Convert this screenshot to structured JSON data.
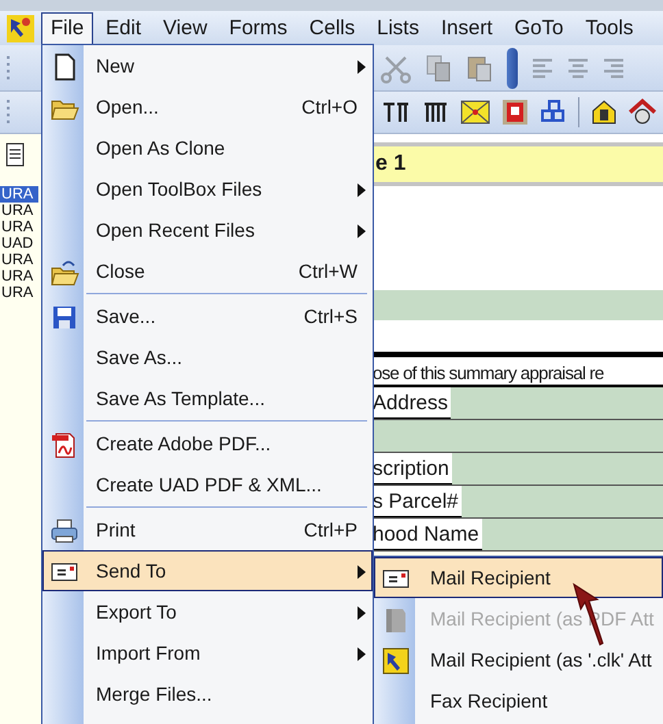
{
  "menu_bar": [
    {
      "label": "File",
      "selected": true
    },
    {
      "label": "Edit",
      "selected": false
    },
    {
      "label": "View",
      "selected": false
    },
    {
      "label": "Forms",
      "selected": false
    },
    {
      "label": "Cells",
      "selected": false
    },
    {
      "label": "Lists",
      "selected": false
    },
    {
      "label": "Insert",
      "selected": false
    },
    {
      "label": "GoTo",
      "selected": false
    },
    {
      "label": "Tools",
      "selected": false
    }
  ],
  "side_panel": {
    "items": [
      {
        "label": "URA",
        "selected": true
      },
      {
        "label": "URA",
        "selected": false
      },
      {
        "label": "URA",
        "selected": false
      },
      {
        "label": "UAD",
        "selected": false
      },
      {
        "label": "URA",
        "selected": false
      },
      {
        "label": "URA",
        "selected": false
      },
      {
        "label": "URA",
        "selected": false
      }
    ]
  },
  "document": {
    "header": "e 1",
    "rows": [
      {
        "kind": "heading",
        "label": "ose of this summary appraisal re"
      },
      {
        "kind": "field",
        "label": "Address"
      },
      {
        "kind": "band"
      },
      {
        "kind": "field",
        "label": "scription"
      },
      {
        "kind": "field",
        "label": "s Parcel#"
      },
      {
        "kind": "field",
        "label": "hood Name"
      }
    ]
  },
  "file_menu": {
    "items": [
      {
        "kind": "item",
        "label": "New",
        "submenu": true,
        "selected": false
      },
      {
        "kind": "item",
        "label": "Open...",
        "shortcut": "Ctrl+O",
        "selected": false
      },
      {
        "kind": "item",
        "label": "Open As Clone",
        "submenu": false,
        "selected": false
      },
      {
        "kind": "item",
        "label": "Open ToolBox Files",
        "submenu": true,
        "selected": false
      },
      {
        "kind": "item",
        "label": "Open Recent Files",
        "submenu": true,
        "selected": false
      },
      {
        "kind": "item",
        "label": "Close",
        "shortcut": "Ctrl+W",
        "selected": false
      },
      {
        "kind": "separator"
      },
      {
        "kind": "item",
        "label": "Save...",
        "shortcut": "Ctrl+S",
        "selected": false
      },
      {
        "kind": "item",
        "label": "Save As...",
        "selected": false
      },
      {
        "kind": "item",
        "label": "Save As Template...",
        "selected": false
      },
      {
        "kind": "separator"
      },
      {
        "kind": "item",
        "label": "Create Adobe PDF...",
        "selected": false
      },
      {
        "kind": "item",
        "label": "Create UAD PDF & XML...",
        "selected": false
      },
      {
        "kind": "separator"
      },
      {
        "kind": "item",
        "label": "Print",
        "shortcut": "Ctrl+P",
        "selected": false
      },
      {
        "kind": "item",
        "label": "Send To",
        "submenu": true,
        "selected": true
      },
      {
        "kind": "item",
        "label": "Export To",
        "submenu": true,
        "selected": false
      },
      {
        "kind": "item",
        "label": "Import From",
        "submenu": true,
        "selected": false
      },
      {
        "kind": "item",
        "label": "Merge Files...",
        "selected": false
      }
    ]
  },
  "send_to_menu": {
    "items": [
      {
        "label": "Mail Recipient",
        "disabled": false,
        "selected": true
      },
      {
        "label": "Mail Recipient (as PDF Att",
        "disabled": true,
        "selected": false
      },
      {
        "label": "Mail Recipient (as '.clk' Att",
        "disabled": false,
        "selected": false
      },
      {
        "label": "Fax Recipient",
        "disabled": false,
        "selected": false
      }
    ]
  }
}
